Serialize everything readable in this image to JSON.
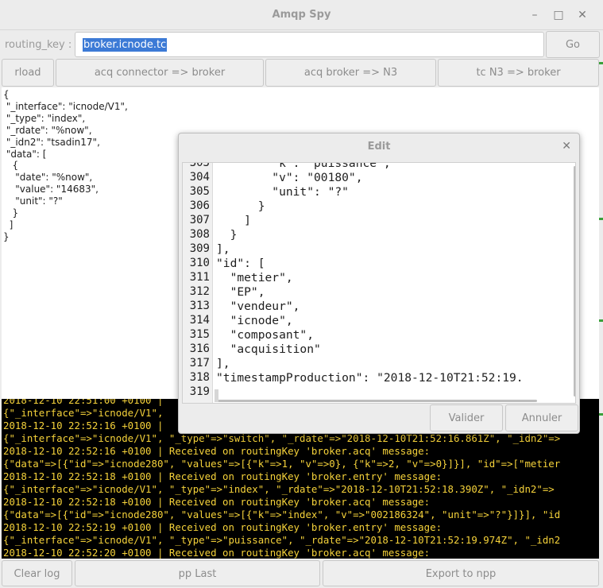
{
  "window": {
    "title": "Amqp Spy"
  },
  "routing": {
    "label": "routing_key :",
    "value": "broker.icnode.tc",
    "go_label": "Go"
  },
  "toolbar": {
    "rload": "rload",
    "acq_connector": "acq connector => broker",
    "acq_broker": "acq broker => N3",
    "tc_n3": "tc N3 => broker"
  },
  "json_view": {
    "lines": [
      "{",
      " \"_interface\": \"icnode/V1\",",
      " \"_type\": \"index\",",
      " \"_rdate\": \"%now\",",
      " \"_idn2\": \"tsadin17\",",
      " \"data\": [",
      "   {",
      "    \"date\": \"%now\",",
      "    \"value\": \"14683\",",
      "    \"unit\": \"?\"",
      "   }",
      "  ]",
      "}"
    ]
  },
  "edit_dialog": {
    "title": "Edit",
    "lines": [
      {
        "n": "303",
        "text": "        \"k\": \"puissance\","
      },
      {
        "n": "304",
        "text": "        \"v\": \"00180\","
      },
      {
        "n": "305",
        "text": "        \"unit\": \"?\""
      },
      {
        "n": "306",
        "text": "      }"
      },
      {
        "n": "307",
        "text": "    ]"
      },
      {
        "n": "308",
        "text": "  }"
      },
      {
        "n": "309",
        "text": "],"
      },
      {
        "n": "310",
        "text": "\"id\": ["
      },
      {
        "n": "311",
        "text": "  \"metier\","
      },
      {
        "n": "312",
        "text": "  \"EP\","
      },
      {
        "n": "313",
        "text": "  \"vendeur\","
      },
      {
        "n": "314",
        "text": "  \"icnode\","
      },
      {
        "n": "315",
        "text": "  \"composant\","
      },
      {
        "n": "316",
        "text": "  \"acquisition\""
      },
      {
        "n": "317",
        "text": "],"
      },
      {
        "n": "318",
        "text": "\"timestampProduction\": \"2018-12-10T21:52:19."
      },
      {
        "n": "319",
        "text": ""
      }
    ],
    "valider": "Valider",
    "annuler": "Annuler"
  },
  "log": {
    "lines": [
      "2018-12-10 22:51:00 +0100 |",
      "{\"_interface\"=>\"icnode/V1\",",
      "2018-12-10 22:52:16 +0100 |",
      "{\"_interface\"=>\"icnode/V1\", \"_type\"=>\"switch\", \"_rdate\"=>\"2018-12-10T21:52:16.861Z\", \"_idn2\"=>",
      "2018-12-10 22:52:16 +0100 | Received on routingKey 'broker.acq' message:",
      "{\"data\"=>[{\"id\"=>\"icnode280\", \"values\"=>[{\"k\"=>1, \"v\"=>0}, {\"k\"=>2, \"v\"=>0}]}], \"id\"=>[\"metier",
      "2018-12-10 22:52:18 +0100 | Received on routingKey 'broker.entry' message:",
      "{\"_interface\"=>\"icnode/V1\", \"_type\"=>\"index\", \"_rdate\"=>\"2018-12-10T21:52:18.390Z\", \"_idn2\"=>",
      "2018-12-10 22:52:18 +0100 | Received on routingKey 'broker.acq' message:",
      "{\"data\"=>[{\"id\"=>\"icnode280\", \"values\"=>[{\"k\"=>\"index\", \"v\"=>\"002186324\", \"unit\"=>\"?\"}]}], \"id",
      "2018-12-10 22:52:19 +0100 | Received on routingKey 'broker.entry' message:",
      "{\"_interface\"=>\"icnode/V1\", \"_type\"=>\"puissance\", \"_rdate\"=>\"2018-12-10T21:52:19.974Z\", \"_idn2",
      "2018-12-10 22:52:20 +0100 | Received on routingKey 'broker.acq' message:"
    ]
  },
  "bottom": {
    "clear_log": "Clear log",
    "pp_last": "pp Last",
    "export": "Export to npp"
  },
  "colors": {
    "selection": "#3c7ad6",
    "log_text": "#f5d23a",
    "log_bg": "#000000"
  }
}
